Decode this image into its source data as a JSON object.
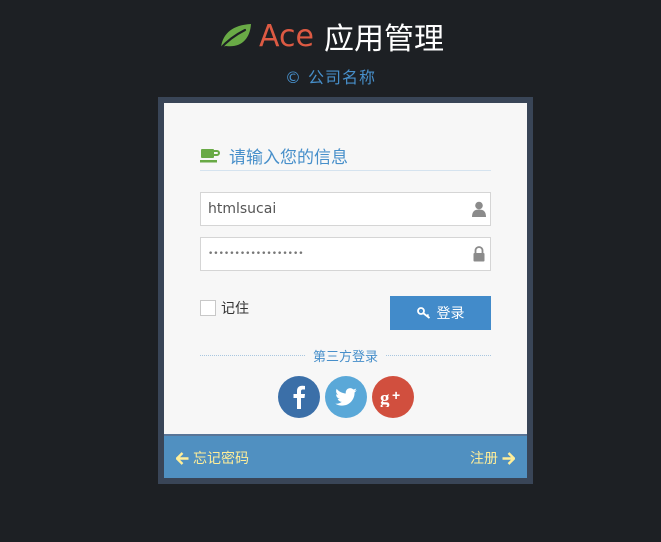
{
  "header": {
    "brand_accent": "Ace",
    "brand_rest": "应用管理",
    "company": "© 公司名称",
    "leaf_icon": "leaf-icon"
  },
  "login": {
    "heading": "请输入您的信息",
    "heading_icon": "coffee-icon",
    "username_value": "htmlsucai",
    "username_icon": "user-icon",
    "password_dots": "••••••••••••••••••",
    "password_icon": "lock-icon",
    "remember_label": "记住",
    "login_button": "登录",
    "login_icon": "key-icon",
    "third_party": "第三方登录"
  },
  "social": [
    {
      "name": "facebook",
      "glyph": "f"
    },
    {
      "name": "twitter",
      "glyph": "twitter-bird"
    },
    {
      "name": "google-plus",
      "glyph": "g+"
    }
  ],
  "footer": {
    "forgot": "忘记密码",
    "register": "注册"
  },
  "colors": {
    "background": "#1d2024",
    "brand_accent": "#dd5a43",
    "link_blue": "#478fca",
    "button_blue": "#428bca",
    "footer_blue": "#5090c1",
    "footer_text": "#ffee99",
    "leaf_green": "#69aa46",
    "facebook": "#3b6fa8",
    "twitter": "#5aa8d8",
    "google_plus": "#d14f3e"
  }
}
